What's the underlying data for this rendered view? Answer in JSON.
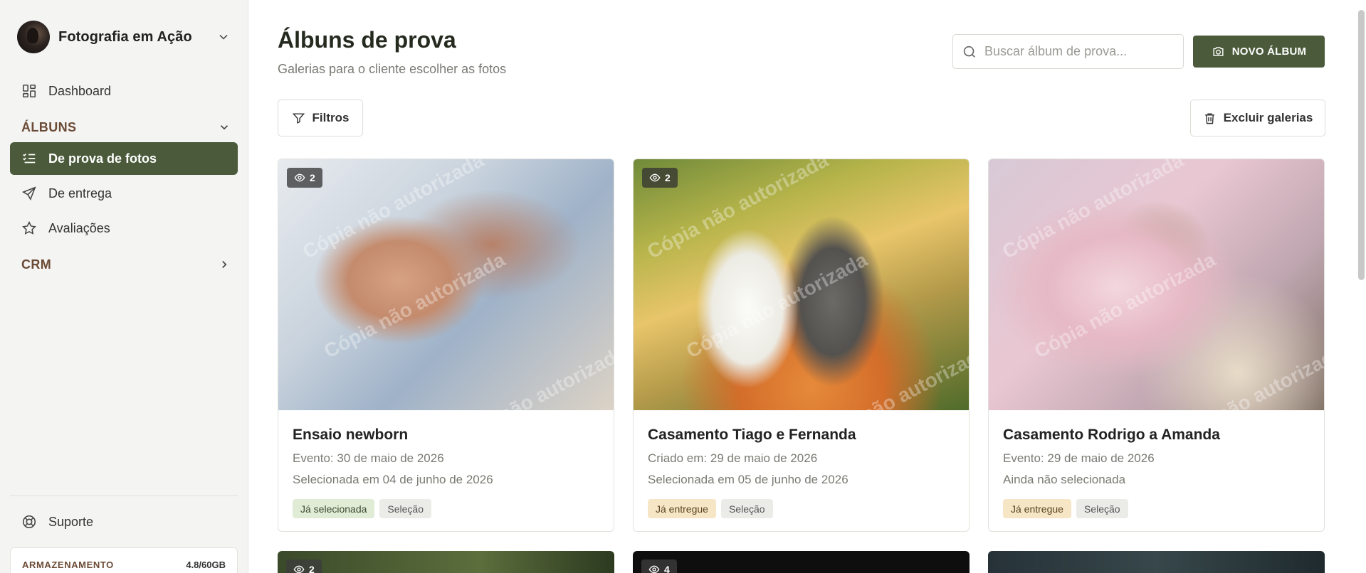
{
  "profile": {
    "name": "Fotografia em Ação"
  },
  "sidebar": {
    "dashboard": "Dashboard",
    "albums_section": "ÁLBUNS",
    "items": [
      {
        "label": "De prova de fotos",
        "icon": "list-check-icon",
        "active": true
      },
      {
        "label": "De entrega",
        "icon": "send-icon"
      },
      {
        "label": "Avaliações",
        "icon": "star-icon"
      }
    ],
    "crm_section": "CRM",
    "support": "Suporte",
    "storage": {
      "label": "ARMAZENAMENTO",
      "value": "4.8/60GB"
    }
  },
  "header": {
    "title": "Álbuns de prova",
    "subtitle": "Galerias para o cliente escolher as fotos",
    "search_placeholder": "Buscar álbum de prova...",
    "new_album": "NOVO ÁLBUM"
  },
  "toolbar": {
    "filters": "Filtros",
    "delete_galleries": "Excluir galerias"
  },
  "albums": [
    {
      "title": "Ensaio newborn",
      "views": "2",
      "line1": "Evento: 30 de maio de 2026",
      "line2": "Selecionada em 04 de junho de 2026",
      "status": "Já selecionada",
      "type": "Seleção"
    },
    {
      "title": "Casamento Tiago e Fernanda",
      "views": "2",
      "line1": "Criado em: 29 de maio de 2026",
      "line2": "Selecionada em 05 de junho de 2026",
      "status": "Já entregue",
      "type": "Seleção"
    },
    {
      "title": "Casamento Rodrigo a Amanda",
      "views": "",
      "line1": "Evento: 29 de maio de 2026",
      "line2": "Ainda não selecionada",
      "status": "Já entregue",
      "type": "Seleção"
    }
  ],
  "albums_peek": [
    {
      "views": "2"
    },
    {
      "views": "4"
    },
    {
      "views": ""
    }
  ],
  "watermark": "Cópia não autorizada",
  "colors": {
    "brand": "#4a5a3a",
    "section_text": "#6b4a36",
    "tag_selected": "#e0ecd6",
    "tag_delivered": "#f6e6c5",
    "tag_type": "#ebebe8"
  }
}
